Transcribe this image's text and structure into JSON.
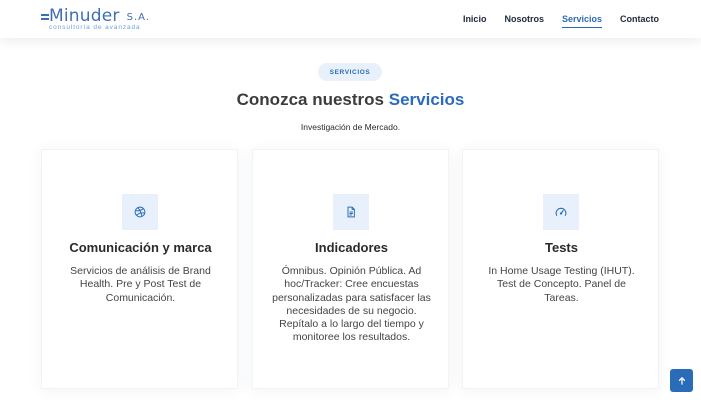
{
  "brand": {
    "name": "Minuder",
    "suffix": "S.A.",
    "tagline": "consultoría de avanzada"
  },
  "nav": {
    "items": [
      "Inicio",
      "Nosotros",
      "Servicios",
      "Contacto"
    ],
    "active": "Servicios"
  },
  "section": {
    "badge": "SERVICIOS",
    "title_prefix": "Conozca nuestros",
    "title_highlight": "Servicios",
    "subtitle": "Investigación de Mercado."
  },
  "cards": [
    {
      "icon": "dribbble-icon",
      "title": "Comunicación y marca",
      "text": "Servicios de análisis de Brand Health. Pre y Post Test de Comunicación."
    },
    {
      "icon": "document-icon",
      "title": "Indicadores",
      "text": "Ómnibus. Opinión Pública. Ad hoc/Tracker: Cree encuestas personalizadas para satisfacer las necesidades de su negocio. Repítalo a lo largo del tiempo y monitoree los resultados."
    },
    {
      "icon": "speedometer-icon",
      "title": "Tests",
      "text": "In Home Usage Testing (IHUT). Test de Concepto. Panel de Tareas."
    }
  ],
  "back_to_top": {
    "icon": "arrow-up-icon"
  },
  "colors": {
    "accent": "#2b6cb8",
    "brand": "#3f6fb0",
    "badge_bg": "#e8f1fb",
    "heading": "#3c3c3c"
  }
}
